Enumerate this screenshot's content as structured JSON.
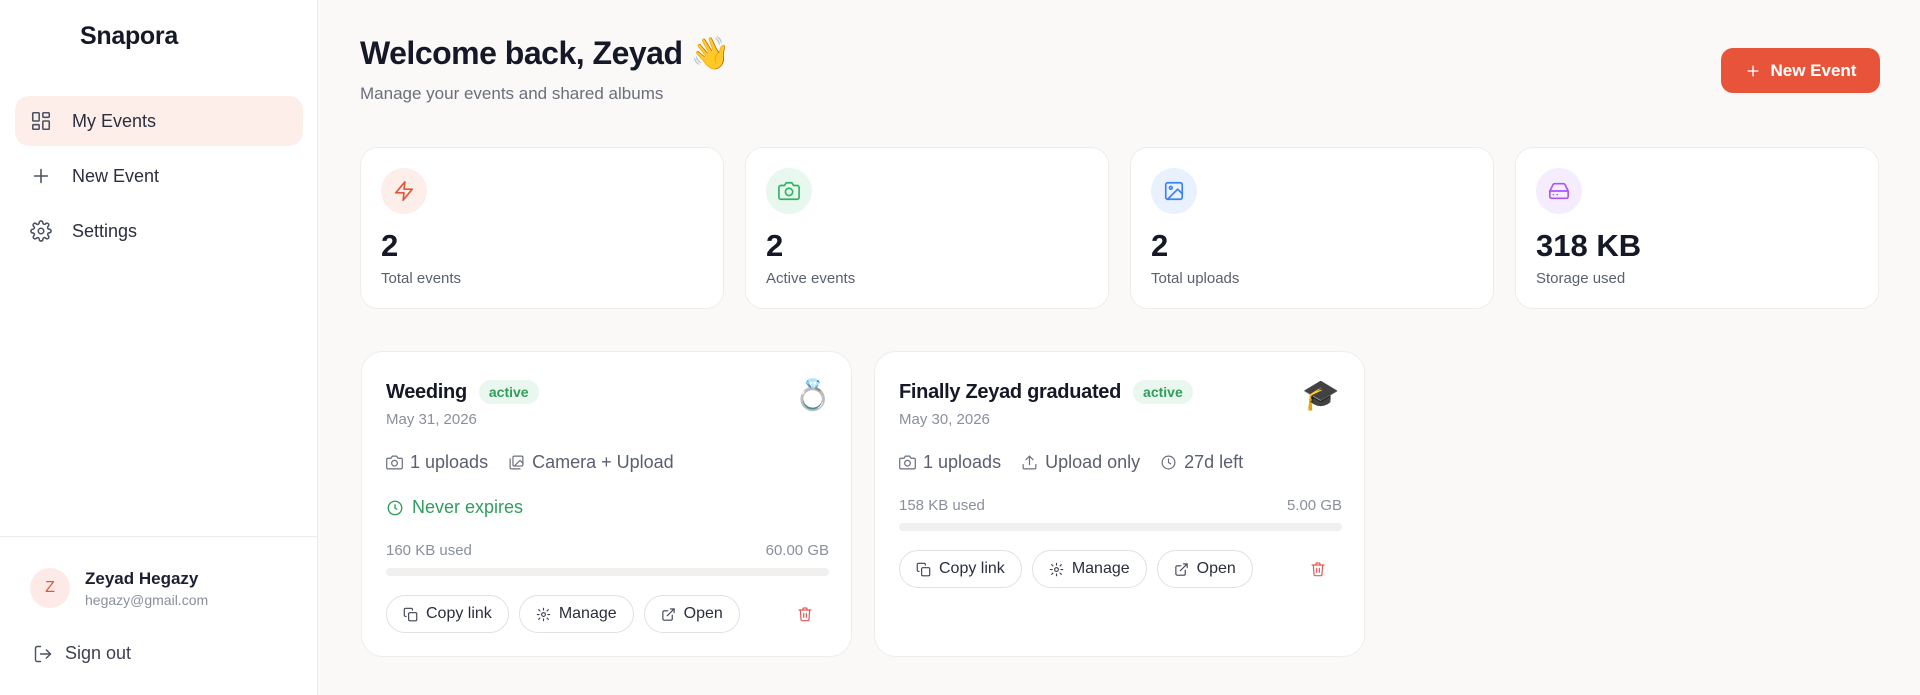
{
  "app": {
    "name": "Snapora"
  },
  "sidebar": {
    "items": [
      {
        "label": "My Events",
        "icon": "dashboard-grid-icon",
        "active": true
      },
      {
        "label": "New Event",
        "icon": "plus-icon",
        "active": false
      },
      {
        "label": "Settings",
        "icon": "gear-icon",
        "active": false
      }
    ],
    "user": {
      "initial": "Z",
      "name": "Zeyad Hegazy",
      "email": "hegazy@gmail.com"
    },
    "sign_out_label": "Sign out"
  },
  "header": {
    "title": "Welcome back, Zeyad 👋",
    "subtitle": "Manage your events and shared albums",
    "new_event_label": "New Event"
  },
  "stats": [
    {
      "value": "2",
      "label": "Total events",
      "icon": "lightning-icon",
      "color": "#e8543a",
      "bg": "#fdeeea"
    },
    {
      "value": "2",
      "label": "Active events",
      "icon": "camera-icon",
      "color": "#2fb463",
      "bg": "#e8f8ee"
    },
    {
      "value": "2",
      "label": "Total uploads",
      "icon": "image-icon",
      "color": "#3b82f6",
      "bg": "#e9f1fe"
    },
    {
      "value": "318 KB",
      "label": "Storage used",
      "icon": "hard-drive-icon",
      "color": "#a855f7",
      "bg": "#f5edfe"
    }
  ],
  "events": [
    {
      "name": "Weeding",
      "status": "active",
      "emoji": "💍",
      "date": "May 31, 2026",
      "uploads": "1 uploads",
      "mode": "Camera + Upload",
      "expiry": "Never expires",
      "used": "160 KB used",
      "limit": "60.00 GB",
      "usage_fraction": 0.0,
      "copy_label": "Copy link",
      "manage_label": "Manage",
      "open_label": "Open"
    },
    {
      "name": "Finally Zeyad graduated",
      "status": "active",
      "emoji": "🎓",
      "date": "May 30, 2026",
      "uploads": "1 uploads",
      "mode": "Upload only",
      "time_left": "27d left",
      "used": "158 KB used",
      "limit": "5.00 GB",
      "usage_fraction": 0.0,
      "copy_label": "Copy link",
      "manage_label": "Manage",
      "open_label": "Open"
    }
  ],
  "colors": {
    "accent": "#e8543a",
    "success": "#2f9e5b",
    "danger": "#e35a58"
  }
}
